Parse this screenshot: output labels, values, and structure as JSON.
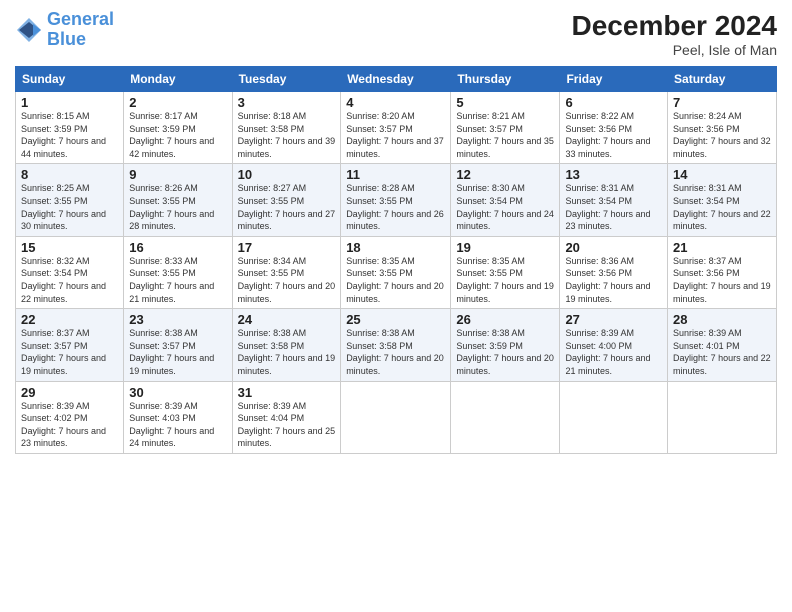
{
  "header": {
    "logo_line1": "General",
    "logo_line2": "Blue",
    "title": "December 2024",
    "subtitle": "Peel, Isle of Man"
  },
  "days_of_week": [
    "Sunday",
    "Monday",
    "Tuesday",
    "Wednesday",
    "Thursday",
    "Friday",
    "Saturday"
  ],
  "weeks": [
    [
      {
        "day": "1",
        "sunrise": "8:15 AM",
        "sunset": "3:59 PM",
        "daylight": "7 hours and 44 minutes."
      },
      {
        "day": "2",
        "sunrise": "8:17 AM",
        "sunset": "3:59 PM",
        "daylight": "7 hours and 42 minutes."
      },
      {
        "day": "3",
        "sunrise": "8:18 AM",
        "sunset": "3:58 PM",
        "daylight": "7 hours and 39 minutes."
      },
      {
        "day": "4",
        "sunrise": "8:20 AM",
        "sunset": "3:57 PM",
        "daylight": "7 hours and 37 minutes."
      },
      {
        "day": "5",
        "sunrise": "8:21 AM",
        "sunset": "3:57 PM",
        "daylight": "7 hours and 35 minutes."
      },
      {
        "day": "6",
        "sunrise": "8:22 AM",
        "sunset": "3:56 PM",
        "daylight": "7 hours and 33 minutes."
      },
      {
        "day": "7",
        "sunrise": "8:24 AM",
        "sunset": "3:56 PM",
        "daylight": "7 hours and 32 minutes."
      }
    ],
    [
      {
        "day": "8",
        "sunrise": "8:25 AM",
        "sunset": "3:55 PM",
        "daylight": "7 hours and 30 minutes."
      },
      {
        "day": "9",
        "sunrise": "8:26 AM",
        "sunset": "3:55 PM",
        "daylight": "7 hours and 28 minutes."
      },
      {
        "day": "10",
        "sunrise": "8:27 AM",
        "sunset": "3:55 PM",
        "daylight": "7 hours and 27 minutes."
      },
      {
        "day": "11",
        "sunrise": "8:28 AM",
        "sunset": "3:55 PM",
        "daylight": "7 hours and 26 minutes."
      },
      {
        "day": "12",
        "sunrise": "8:30 AM",
        "sunset": "3:54 PM",
        "daylight": "7 hours and 24 minutes."
      },
      {
        "day": "13",
        "sunrise": "8:31 AM",
        "sunset": "3:54 PM",
        "daylight": "7 hours and 23 minutes."
      },
      {
        "day": "14",
        "sunrise": "8:31 AM",
        "sunset": "3:54 PM",
        "daylight": "7 hours and 22 minutes."
      }
    ],
    [
      {
        "day": "15",
        "sunrise": "8:32 AM",
        "sunset": "3:54 PM",
        "daylight": "7 hours and 22 minutes."
      },
      {
        "day": "16",
        "sunrise": "8:33 AM",
        "sunset": "3:55 PM",
        "daylight": "7 hours and 21 minutes."
      },
      {
        "day": "17",
        "sunrise": "8:34 AM",
        "sunset": "3:55 PM",
        "daylight": "7 hours and 20 minutes."
      },
      {
        "day": "18",
        "sunrise": "8:35 AM",
        "sunset": "3:55 PM",
        "daylight": "7 hours and 20 minutes."
      },
      {
        "day": "19",
        "sunrise": "8:35 AM",
        "sunset": "3:55 PM",
        "daylight": "7 hours and 19 minutes."
      },
      {
        "day": "20",
        "sunrise": "8:36 AM",
        "sunset": "3:56 PM",
        "daylight": "7 hours and 19 minutes."
      },
      {
        "day": "21",
        "sunrise": "8:37 AM",
        "sunset": "3:56 PM",
        "daylight": "7 hours and 19 minutes."
      }
    ],
    [
      {
        "day": "22",
        "sunrise": "8:37 AM",
        "sunset": "3:57 PM",
        "daylight": "7 hours and 19 minutes."
      },
      {
        "day": "23",
        "sunrise": "8:38 AM",
        "sunset": "3:57 PM",
        "daylight": "7 hours and 19 minutes."
      },
      {
        "day": "24",
        "sunrise": "8:38 AM",
        "sunset": "3:58 PM",
        "daylight": "7 hours and 19 minutes."
      },
      {
        "day": "25",
        "sunrise": "8:38 AM",
        "sunset": "3:58 PM",
        "daylight": "7 hours and 20 minutes."
      },
      {
        "day": "26",
        "sunrise": "8:38 AM",
        "sunset": "3:59 PM",
        "daylight": "7 hours and 20 minutes."
      },
      {
        "day": "27",
        "sunrise": "8:39 AM",
        "sunset": "4:00 PM",
        "daylight": "7 hours and 21 minutes."
      },
      {
        "day": "28",
        "sunrise": "8:39 AM",
        "sunset": "4:01 PM",
        "daylight": "7 hours and 22 minutes."
      }
    ],
    [
      {
        "day": "29",
        "sunrise": "8:39 AM",
        "sunset": "4:02 PM",
        "daylight": "7 hours and 23 minutes."
      },
      {
        "day": "30",
        "sunrise": "8:39 AM",
        "sunset": "4:03 PM",
        "daylight": "7 hours and 24 minutes."
      },
      {
        "day": "31",
        "sunrise": "8:39 AM",
        "sunset": "4:04 PM",
        "daylight": "7 hours and 25 minutes."
      },
      null,
      null,
      null,
      null
    ]
  ]
}
